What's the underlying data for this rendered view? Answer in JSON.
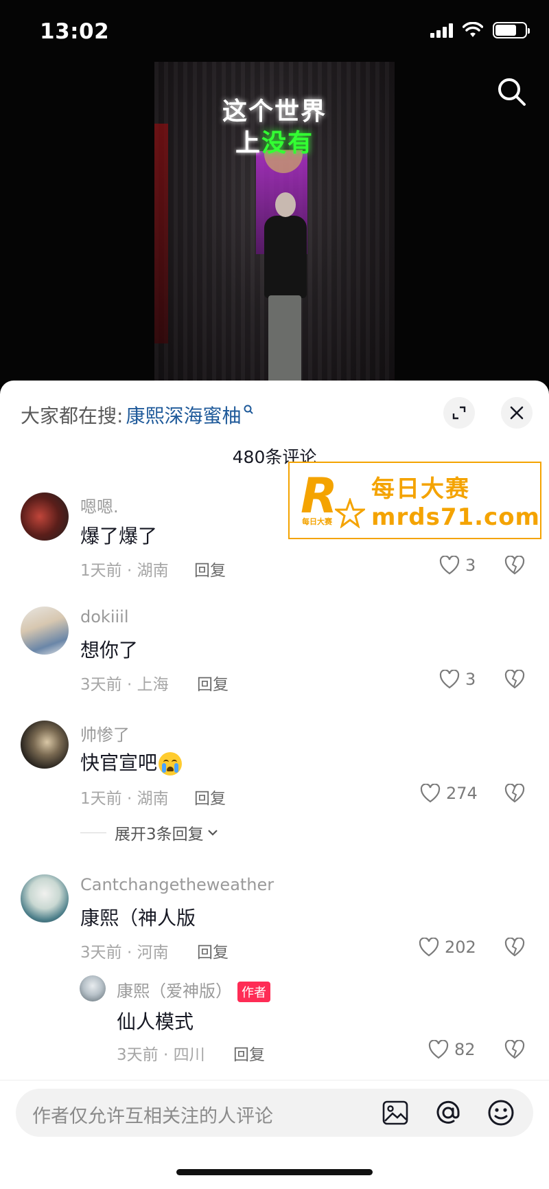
{
  "status_bar": {
    "time": "13:02",
    "battery_level": 0.72
  },
  "video": {
    "caption_line1": "这个世界",
    "caption_line2_white": "上",
    "caption_line2_green": "没有"
  },
  "watermark": {
    "logo_letter": "R",
    "logo_small": "每日大赛",
    "name": "每日大赛",
    "domain": "mrds71.com",
    "color": "#f4a300"
  },
  "panel": {
    "search_label": "大家都在搜:",
    "search_keyword": "康熙深海蜜柚",
    "comment_count": "480条评论"
  },
  "comments": [
    {
      "user": "嗯嗯.",
      "text": "爆了爆了",
      "meta": "1天前 · 湖南",
      "reply": "回复",
      "likes": "3"
    },
    {
      "user": "dokiiil",
      "text": "想你了",
      "meta": "3天前 · 上海",
      "reply": "回复",
      "likes": "3"
    },
    {
      "user": "帅惨了",
      "text": "快官宣吧",
      "meta": "1天前 · 湖南",
      "reply": "回复",
      "likes": "274",
      "expand": "展开3条回复"
    },
    {
      "user": "Cantchangetheweather",
      "text": "康熙（神人版",
      "meta": "3天前 · 河南",
      "reply": "回复",
      "likes": "202"
    }
  ],
  "author_reply": {
    "user": "康熙（爱神版）",
    "badge": "作者",
    "text": "仙人模式",
    "meta": "3天前 · 四川",
    "reply": "回复",
    "likes": "82"
  },
  "input": {
    "placeholder": "作者仅允许互相关注的人评论"
  },
  "colors": {
    "accent_red": "#fe2c55",
    "link_blue": "#1f5a9a"
  }
}
